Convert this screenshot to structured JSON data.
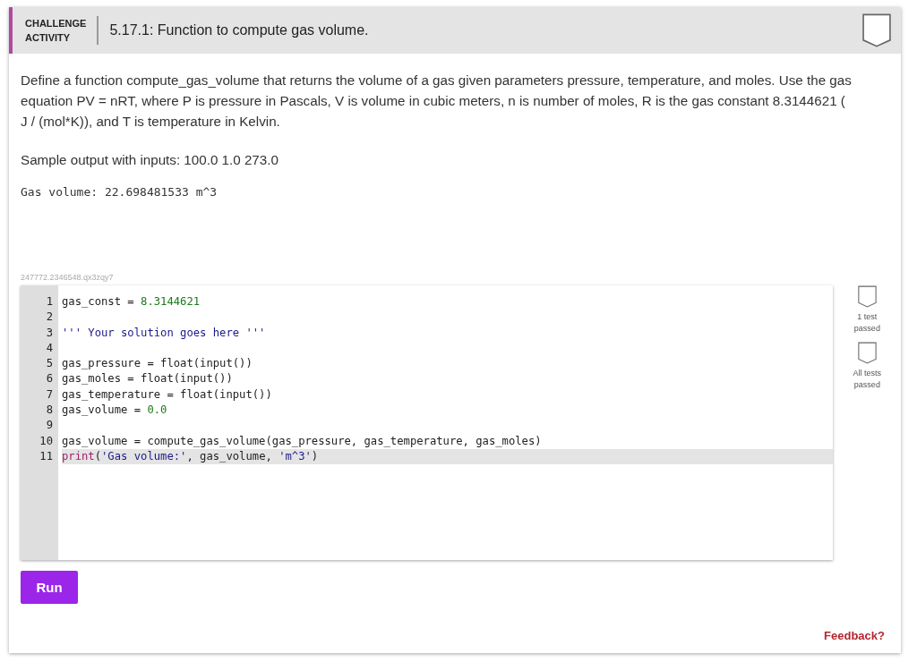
{
  "header": {
    "label_lines": [
      "CHALLENGE",
      "ACTIVITY"
    ],
    "title": "5.17.1: Function to compute gas volume.",
    "completed": false
  },
  "instructions": "Define a function compute_gas_volume that returns the volume of a gas given parameters pressure, temperature, and moles. Use the gas equation PV = nRT, where P is pressure in Pascals, V is volume in cubic meters, n is number of moles, R is the gas constant 8.3144621 ( J / (mol*K)), and T is temperature in Kelvin.",
  "sample_label": "Sample output with inputs: 100.0 1.0 273.0",
  "sample_output": "Gas volume: 22.698481533 m^3",
  "activity_id": "247772.2346548.qx3zqy7",
  "code_lines": [
    {
      "number": "1",
      "current": false,
      "tokens": [
        {
          "text": "gas_const = ",
          "kind": "plain"
        },
        {
          "text": "8.3144621",
          "kind": "number"
        }
      ]
    },
    {
      "number": "2",
      "current": false
    },
    {
      "number": "3",
      "current": false,
      "tokens": [
        {
          "text": "''' Your solution goes here '''",
          "kind": "string"
        }
      ]
    },
    {
      "number": "4",
      "current": false
    },
    {
      "number": "5",
      "current": false,
      "tokens": [
        {
          "text": "gas_pressure = float(input())",
          "kind": "plain"
        }
      ]
    },
    {
      "number": "6",
      "current": false,
      "tokens": [
        {
          "text": "gas_moles = float(input())",
          "kind": "plain"
        }
      ]
    },
    {
      "number": "7",
      "current": false,
      "tokens": [
        {
          "text": "gas_temperature = float(input())",
          "kind": "plain"
        }
      ]
    },
    {
      "number": "8",
      "current": false,
      "tokens": [
        {
          "text": "gas_volume = ",
          "kind": "plain"
        },
        {
          "text": "0.0",
          "kind": "number"
        }
      ]
    },
    {
      "number": "9",
      "current": false
    },
    {
      "number": "10",
      "current": false,
      "tokens": [
        {
          "text": "gas_volume = compute_gas_volume(gas_pressure, gas_temperature, gas_moles)",
          "kind": "plain"
        }
      ]
    },
    {
      "number": "11",
      "current": true,
      "tokens": [
        {
          "text": "print",
          "kind": "builtin"
        },
        {
          "text": "(",
          "kind": "plain"
        },
        {
          "text": "'Gas volume:'",
          "kind": "string"
        },
        {
          "text": ", gas_volume, ",
          "kind": "plain"
        },
        {
          "text": "'m^3'",
          "kind": "string"
        },
        {
          "text": ")",
          "kind": "plain"
        }
      ]
    }
  ],
  "tests": [
    {
      "label": "1 test passed",
      "passed": false
    },
    {
      "label": "All tests passed",
      "passed": false
    }
  ],
  "run_button": "Run",
  "feedback_link": "Feedback?"
}
